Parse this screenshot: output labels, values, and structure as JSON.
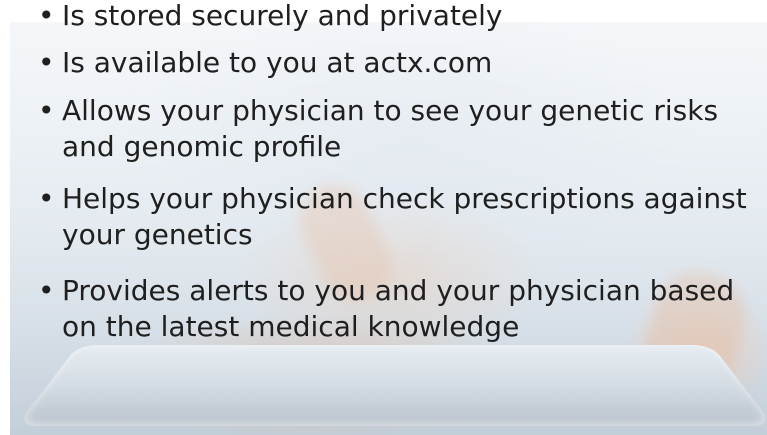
{
  "bullets": [
    {
      "symbol": "•",
      "text": "Is stored securely and privately"
    },
    {
      "symbol": "•",
      "text": "Is available to you at actx.com"
    },
    {
      "symbol": "•",
      "text": "Allows your physician to see your genetic risks and genomic profile"
    },
    {
      "symbol": "•",
      "text": "Helps your physician check prescriptions against your genetics"
    },
    {
      "symbol": "•",
      "text": "Provides alerts to you and your physician based on the latest medical knowledge"
    }
  ]
}
